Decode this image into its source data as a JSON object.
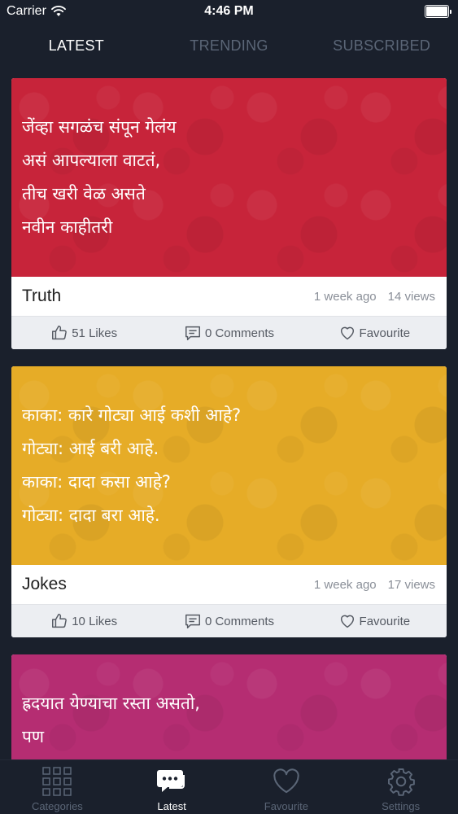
{
  "status_bar": {
    "carrier": "Carrier",
    "time": "4:46 PM"
  },
  "top_tabs": [
    {
      "label": "LATEST",
      "active": true
    },
    {
      "label": "TRENDING",
      "active": false
    },
    {
      "label": "SUBSCRIBED",
      "active": false
    }
  ],
  "cards": [
    {
      "bg_color": "#c7243a",
      "quote_lines": [
        "जेंव्हा सगळंच संपून गेलंय",
        "असं आपल्याला वाटतं,",
        "तीच खरी वेळ असते",
        "नवीन काहीतरी"
      ],
      "category": "Truth",
      "time": "1 week ago",
      "views": "14 views",
      "likes": "51 Likes",
      "comments": "0 Comments",
      "favourite": "Favourite"
    },
    {
      "bg_color": "#e6ac27",
      "quote_lines": [
        "काका: कारे गोट्या आई कशी आहे?",
        "गोट्या: आई बरी आहे.",
        "काका: दादा कसा आहे?",
        "गोट्या: दादा बरा आहे."
      ],
      "category": "Jokes",
      "time": "1 week ago",
      "views": "17 views",
      "likes": "10 Likes",
      "comments": "0 Comments",
      "favourite": "Favourite"
    },
    {
      "bg_color": "#b52d72",
      "quote_lines": [
        "ह्रदयात येण्याचा रस्ता असतो,",
        "पण"
      ]
    }
  ],
  "bottom_tabs": [
    {
      "label": "Categories",
      "icon": "grid-icon",
      "active": false
    },
    {
      "label": "Latest",
      "icon": "chat-icon",
      "active": true
    },
    {
      "label": "Favourite",
      "icon": "heart-icon",
      "active": false
    },
    {
      "label": "Settings",
      "icon": "gear-icon",
      "active": false
    }
  ]
}
